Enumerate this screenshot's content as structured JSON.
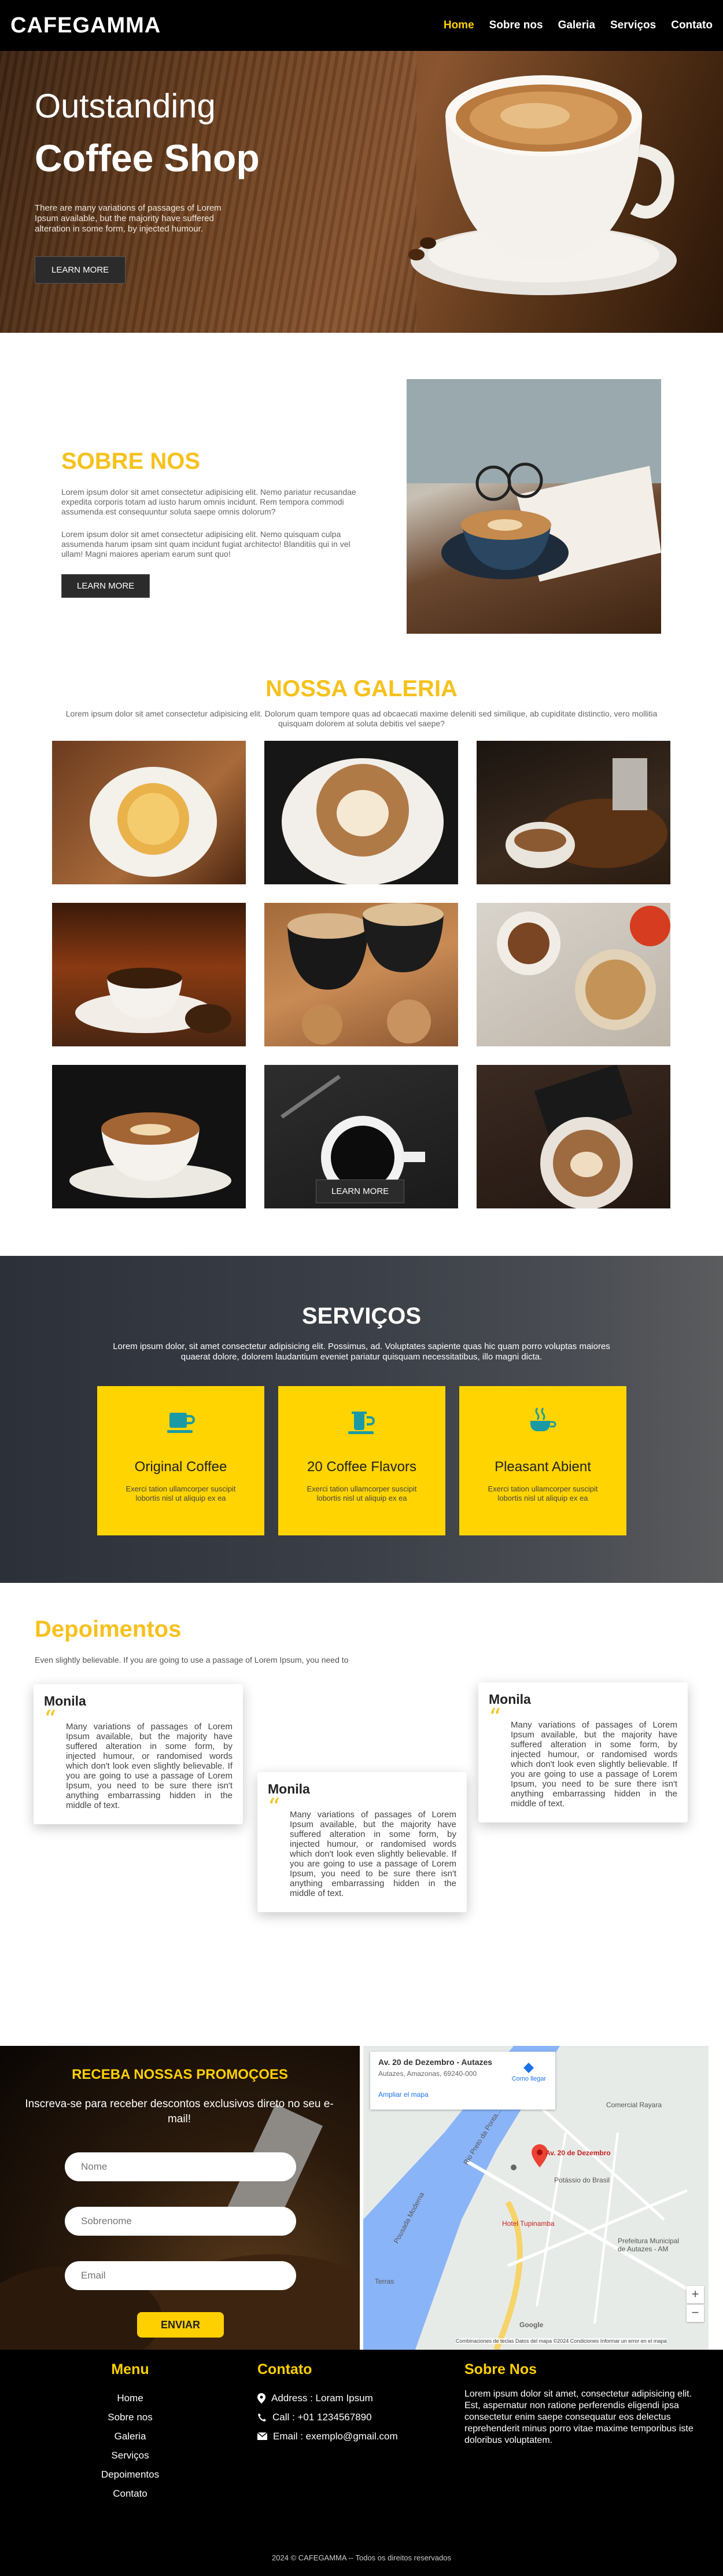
{
  "nav": {
    "brand": "CAFEGAMMA",
    "links": [
      "Home",
      "Sobre nos",
      "Galeria",
      "Serviços",
      "Contato"
    ]
  },
  "hero": {
    "subtitle": "Outstanding",
    "title": "Coffee Shop",
    "description": "There are many variations of passages of Lorem Ipsum available, but the majority have suffered alteration in some form, by injected humour.",
    "button": "LEARN MORE"
  },
  "sobre": {
    "title": "SOBRE NOS",
    "p1": "Lorem ipsum dolor sit amet consectetur adipisicing elit. Nemo pariatur recusandae expedita corporis totam ad iusto harum omnis incidunt. Rem tempora commodi assumenda est consequuntur soluta saepe omnis dolorum?",
    "p2": "Lorem ipsum dolor sit amet consectetur adipisicing elit. Nemo quisquam culpa assumenda harum ipsam sint quam incidunt fugiat architecto! Blanditiis qui in vel ullam! Magni maiores aperiam earum sunt quo!",
    "button": "LEARN MORE"
  },
  "galeria": {
    "title": "NOSSA GALERIA",
    "description": "Lorem ipsum dolor sit amet consectetur adipisicing elit. Dolorum quam tempore quas ad obcaecati maxime deleniti sed similique, ab cupiditate distinctio, vero mollitia quisquam dolorem at soluta debitis vel saepe?",
    "button": "LEARN MORE"
  },
  "servicos": {
    "title": "SERVIÇOS",
    "description": "Lorem ipsum dolor, sit amet consectetur adipisicing elit. Possimus, ad. Voluptates sapiente quas hic quam porro voluptas maiores quaerat dolore, dolorem laudantium eveniet pariatur quisquam necessitatibus, illo magni dicta.",
    "cards": [
      {
        "title": "Original Coffee",
        "text": "Exerci tation ullamcorper suscipit lobortis nisl ut aliquip ex ea",
        "icon": "coffee-cup-icon"
      },
      {
        "title": "20 Coffee Flavors",
        "text": "Exerci tation ullamcorper suscipit lobortis nisl ut aliquip ex ea",
        "icon": "coffee-pot-icon"
      },
      {
        "title": "Pleasant Abient",
        "text": "Exerci tation ullamcorper suscipit lobortis nisl ut aliquip ex ea",
        "icon": "hot-cup-icon"
      }
    ]
  },
  "depoimentos": {
    "title": "Depoimentos",
    "subtitle": "Even slightly believable. If you are going to use a passage of Lorem Ipsum, you need to",
    "items": [
      {
        "name": "Monila",
        "text": "Many variations of passages of Lorem Ipsum available, but the majority have suffered alteration in some form, by injected humour, or randomised words which don't look even slightly believable. If you are going to use a passage of Lorem Ipsum, you need to be sure there isn't anything embarrassing hidden in the middle of text."
      },
      {
        "name": "Monila",
        "text": "Many variations of passages of Lorem Ipsum available, but the majority have suffered alteration in some form, by injected humour, or randomised words which don't look even slightly believable. If you are going to use a passage of Lorem Ipsum, you need to be sure there isn't anything embarrassing hidden in the middle of text."
      },
      {
        "name": "Monila",
        "text": "Many variations of passages of Lorem Ipsum available, but the majority have suffered alteration in some form, by injected humour, or randomised words which don't look even slightly believable. If you are going to use a passage of Lorem Ipsum, you need to be sure there isn't anything embarrassing hidden in the middle of text."
      }
    ]
  },
  "promo": {
    "title": "RECEBA NOSSAS PROMOÇOES",
    "description": "Inscreva-se para receber descontos exclusivos direto no seu e-mail!",
    "placeholders": {
      "nome": "Nome",
      "sobrenome": "Sobrenome",
      "email": "Email"
    },
    "button": "ENVIAR"
  },
  "map": {
    "address": "Av. 20 de Dezembro - Autazes",
    "region": "Autazes, Amazonas, 69240-000",
    "route": "Como llegar",
    "enlarge": "Ampliar el mapa",
    "labels": [
      "Comercial Rayara",
      "Rio Preto da Ponta...",
      "Av. 20 de Dezembro",
      "Pousada Moderna",
      "Hotel Tupinamba",
      "Prefeitura Municipal de Autazes - AM",
      "Potássio do Brasil",
      "Terras"
    ],
    "footer_text": "Combinaciones de teclas  Datos del mapa ©2024  Condiciones  Informar un error en el mapa",
    "google": "Google"
  },
  "footer": {
    "menu_title": "Menu",
    "menu_items": [
      "Home",
      "Sobre nos",
      "Galeria",
      "Serviços",
      "Depoimentos",
      "Contato"
    ],
    "contact_title": "Contato",
    "address": "Address : Loram Ipsum",
    "call": "Call : +01 1234567890",
    "email": "Email : exemplo@gmail.com",
    "sobre_title": "Sobre Nos",
    "sobre_text": "Lorem ipsum dolor sit amet, consectetur adipisicing elit. Est, aspernatur non ratione perferendis eligendi ipsa consectetur enim saepe consequatur eos delectus reprehenderit minus porro vitae maxime temporibus iste doloribus voluptatem.",
    "copyright": "2024 © CAFEGAMMA -- Todos os direitos reservados"
  },
  "colors": {
    "accent": "#ffd000",
    "title_yellow": "#f6c11c",
    "dark": "#000000"
  }
}
